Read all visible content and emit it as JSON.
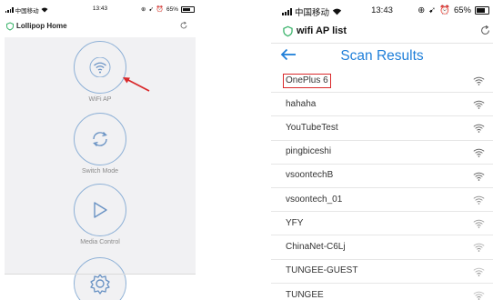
{
  "left": {
    "status": {
      "carrier": "中国移动",
      "time": "13:43",
      "battery": "65%"
    },
    "app_title": "Lollipop Home",
    "menu": [
      {
        "label": "WiFi AP",
        "icon": "wifi-icon"
      },
      {
        "label": "Switch Mode",
        "icon": "sync-icon"
      },
      {
        "label": "Media Control",
        "icon": "play-icon"
      },
      {
        "label": "",
        "icon": "gear-icon"
      }
    ],
    "annotation_color": "#d9292b"
  },
  "right": {
    "status": {
      "carrier": "中国移动",
      "time": "13:43",
      "battery": "65%"
    },
    "app_title": "wifi AP list",
    "page_title": "Scan Results",
    "accent_color": "#1f7fd9",
    "networks": [
      {
        "name": "OnePlus 6",
        "highlighted": true
      },
      {
        "name": "hahaha"
      },
      {
        "name": "YouTubeTest"
      },
      {
        "name": "pingbiceshi"
      },
      {
        "name": "vsoontechB"
      },
      {
        "name": "vsoontech_01"
      },
      {
        "name": "YFY"
      },
      {
        "name": "ChinaNet-C6Lj"
      },
      {
        "name": "TUNGEE-GUEST"
      },
      {
        "name": "TUNGEE"
      }
    ]
  }
}
